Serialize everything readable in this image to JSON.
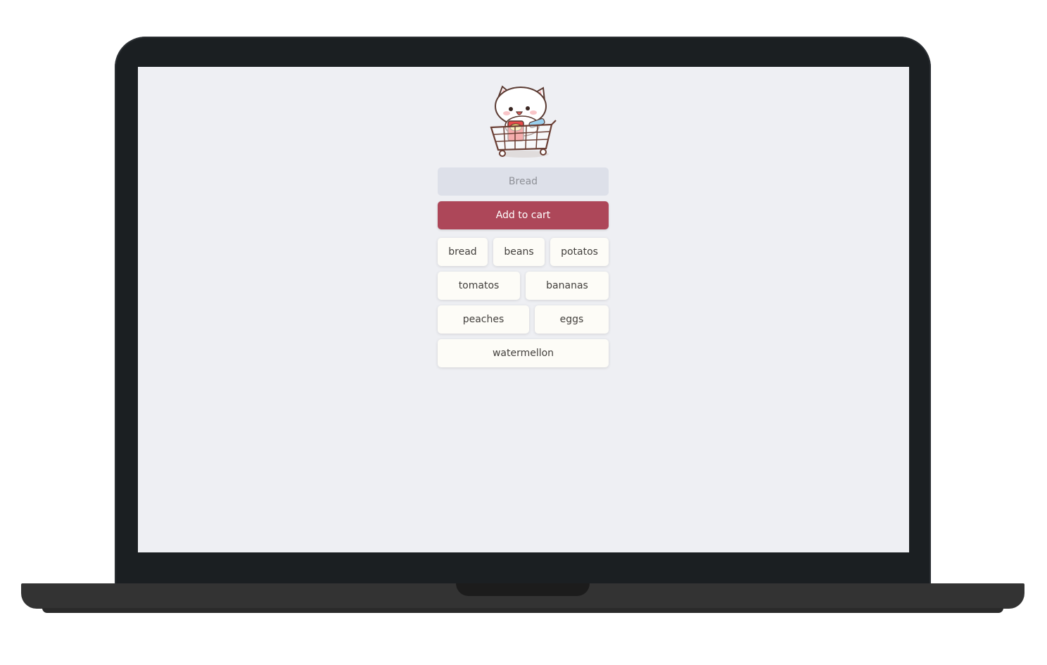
{
  "app": {
    "input": {
      "placeholder": "Bread",
      "value": ""
    },
    "add_button_label": "Add to cart",
    "items": [
      {
        "label": "bread"
      },
      {
        "label": "beans"
      },
      {
        "label": "potatos"
      },
      {
        "label": "tomatos"
      },
      {
        "label": "bananas"
      },
      {
        "label": "peaches"
      },
      {
        "label": "eggs"
      },
      {
        "label": "watermellon"
      }
    ]
  },
  "colors": {
    "button": "#ad4759",
    "input_bg": "#dde0e9",
    "screen_bg": "#eeeff3",
    "chip_bg": "#fdfcf7",
    "laptop_frame": "#1b1f22"
  },
  "icons": {
    "mascot": "cat-in-shopping-cart-icon"
  }
}
